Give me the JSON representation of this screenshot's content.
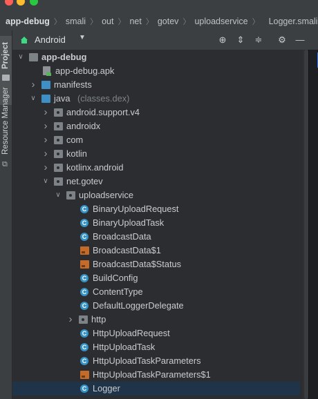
{
  "window": {
    "traffic_lights": [
      "#ff5f57",
      "#febc2e",
      "#28c840"
    ]
  },
  "breadcrumb": {
    "items": [
      "app-debug",
      "smali",
      "out",
      "net",
      "gotev",
      "uploadservice",
      "Logger.smali"
    ]
  },
  "tool_stripe": {
    "project_label": "Project",
    "resource_manager_label": "Resource Manager"
  },
  "toolbar": {
    "view_mode": "Android"
  },
  "tree": {
    "rows": [
      {
        "label": "app-debug",
        "bold": true,
        "arrow": "down",
        "icon": "module-folder-icon"
      },
      {
        "label": "app-debug.apk",
        "arrow": "",
        "icon": "apk-file-icon"
      },
      {
        "label": "manifests",
        "arrow": "right",
        "icon": "folder-icon"
      },
      {
        "label": "java",
        "suffix": "(classes.dex)",
        "arrow": "down",
        "icon": "folder-icon"
      },
      {
        "label": "android.support.v4",
        "arrow": "right",
        "icon": "package-icon"
      },
      {
        "label": "androidx",
        "arrow": "right",
        "icon": "package-icon"
      },
      {
        "label": "com",
        "arrow": "right",
        "icon": "package-icon"
      },
      {
        "label": "kotlin",
        "arrow": "right",
        "icon": "package-icon"
      },
      {
        "label": "kotlinx.android",
        "arrow": "right",
        "icon": "package-icon"
      },
      {
        "label": "net.gotev",
        "arrow": "down",
        "icon": "package-icon"
      },
      {
        "label": "uploadservice",
        "arrow": "down",
        "icon": "package-icon"
      },
      {
        "label": "BinaryUploadRequest",
        "icon": "class-icon"
      },
      {
        "label": "BinaryUploadTask",
        "icon": "class-icon"
      },
      {
        "label": "BroadcastData",
        "icon": "class-icon"
      },
      {
        "label": "BroadcastData$1",
        "icon": "smali-file-icon"
      },
      {
        "label": "BroadcastData$Status",
        "icon": "smali-file-icon"
      },
      {
        "label": "BuildConfig",
        "icon": "class-icon"
      },
      {
        "label": "ContentType",
        "icon": "class-icon"
      },
      {
        "label": "DefaultLoggerDelegate",
        "icon": "class-icon"
      },
      {
        "label": "http",
        "arrow": "right",
        "icon": "package-icon"
      },
      {
        "label": "HttpUploadRequest",
        "icon": "class-icon"
      },
      {
        "label": "HttpUploadTask",
        "icon": "class-icon"
      },
      {
        "label": "HttpUploadTaskParameters",
        "icon": "class-icon"
      },
      {
        "label": "HttpUploadTaskParameters$1",
        "icon": "smali-file-icon"
      },
      {
        "label": "Logger",
        "icon": "class-icon",
        "selected": true
      }
    ]
  }
}
